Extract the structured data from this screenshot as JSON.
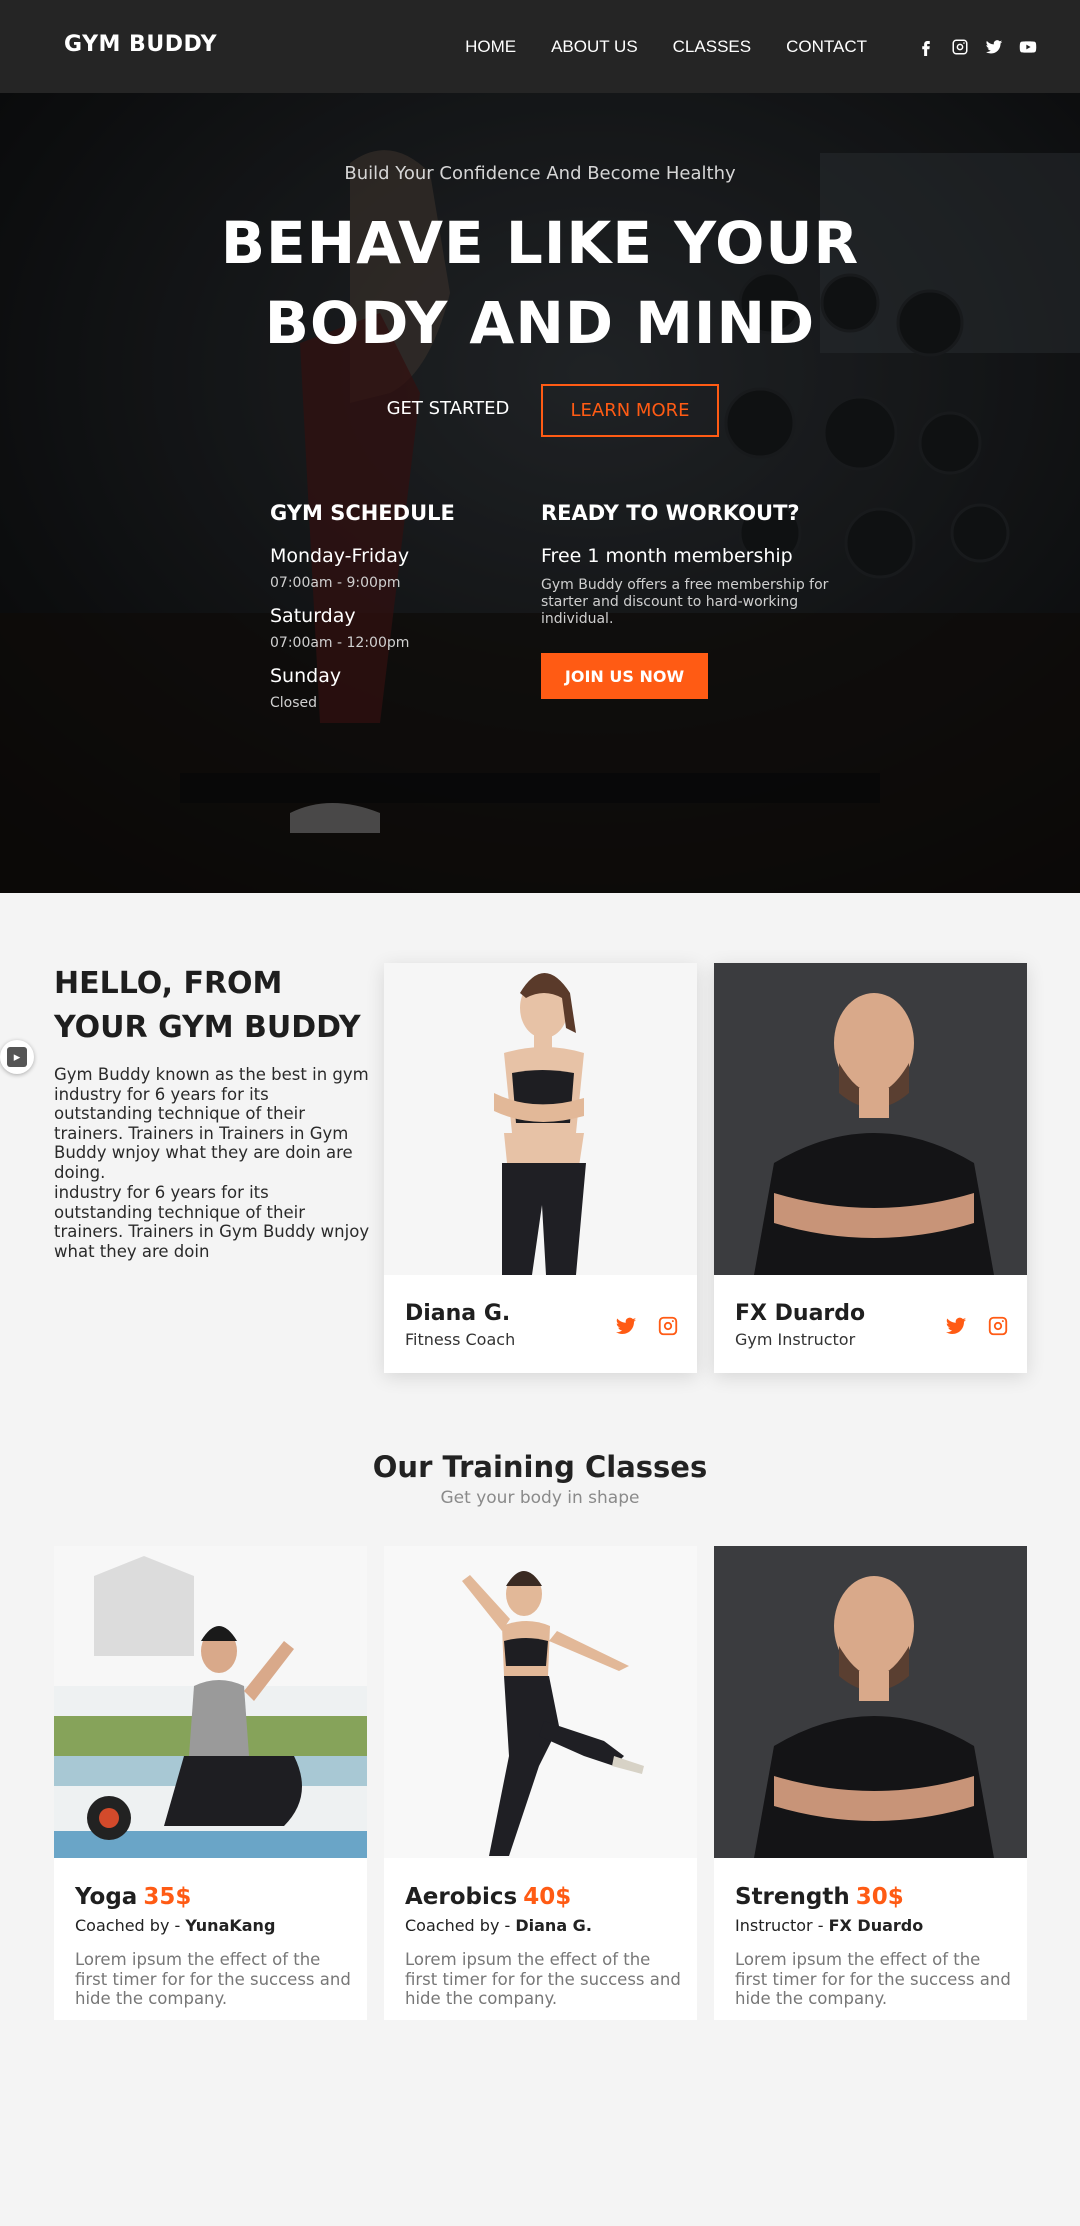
{
  "header": {
    "brand": "GYM BUDDY",
    "nav": [
      "HOME",
      "ABOUT US",
      "CLASSES",
      "CONTACT"
    ],
    "social_icons": [
      "facebook-icon",
      "instagram-icon",
      "twitter-icon",
      "youtube-icon"
    ]
  },
  "hero": {
    "subtitle": "Build Your Confidence And Become Healthy",
    "title_line1": "BEHAVE LIKE YOUR",
    "title_line2": "BODY AND MIND",
    "get_started": "GET STARTED",
    "learn_more": "LEARN MORE",
    "schedule": {
      "title": "GYM SCHEDULE",
      "days": [
        {
          "day": "Monday-Friday",
          "hours": "07:00am - 9:00pm"
        },
        {
          "day": "Saturday",
          "hours": "07:00am - 12:00pm"
        },
        {
          "day": "Sunday",
          "hours": "Closed"
        }
      ]
    },
    "ready": {
      "title": "READY TO WORKOUT?",
      "lead": "Free 1 month membership",
      "desc": "Gym Buddy offers a free membership for starter and discount to hard-working individual.",
      "join": "JOIN US NOW"
    }
  },
  "hello": {
    "title_line1": "HELLO, FROM",
    "title_line2": "YOUR GYM BUDDY",
    "p1": "Gym Buddy known as the best in gym industry for 6 years for its outstanding technique of their trainers. Trainers in Trainers in Gym Buddy wnjoy what they are doin are doing.",
    "p2": "industry for 6 years for its outstanding technique of their trainers. Trainers in Gym Buddy wnjoy what they are doin"
  },
  "trainers": [
    {
      "name": "Diana G.",
      "role": "Fitness Coach"
    },
    {
      "name": "FX Duardo",
      "role": "Gym Instructor"
    }
  ],
  "classes": {
    "title": "Our Training Classes",
    "subtitle": "Get your body in shape",
    "items": [
      {
        "name": "Yoga",
        "price": "35$",
        "coach_label": "Coached by - ",
        "coach": "YunaKang",
        "desc": "Lorem ipsum the effect of the first timer for for the success and hide the company."
      },
      {
        "name": "Aerobics",
        "price": "40$",
        "coach_label": "Coached by - ",
        "coach": "Diana G.",
        "desc": "Lorem ipsum the effect of the first timer for for the success and hide the company."
      },
      {
        "name": "Strength",
        "price": "30$",
        "coach_label": "Instructor - ",
        "coach": "FX Duardo",
        "desc": "Lorem ipsum the effect of the first timer for for the success and hide the company."
      }
    ]
  },
  "colors": {
    "accent": "#ff5b14",
    "header_bg": "#252525",
    "page_bg": "#f4f4f4"
  }
}
